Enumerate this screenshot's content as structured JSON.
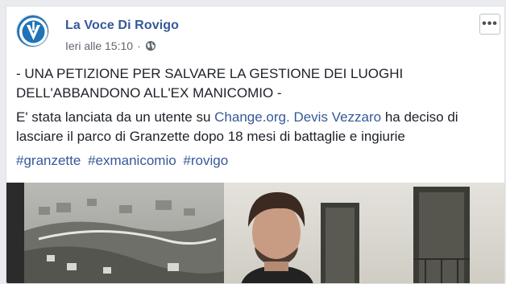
{
  "post": {
    "page_name": "La Voce Di Rovigo",
    "timestamp": "Ieri alle 15:10",
    "meta_separator": "·",
    "more_label": "•••",
    "headline": "- UNA PETIZIONE PER SALVARE LA GESTIONE DEI LUOGHI DELL'ABBANDONO ALL'EX MANICOMIO -",
    "body": {
      "part1": "E' stata lanciata da un utente su ",
      "link1": "Change.org.",
      "space": " ",
      "link2": "Devis Vezzaro",
      "part2": " ha deciso di lasciare il parco di Granzette dopo 18 mesi di battaglie e ingiurie"
    },
    "hashtags": [
      "#granzette",
      "#exmanicomio",
      "#rovigo"
    ]
  },
  "colors": {
    "link": "#365899",
    "text": "#1d2129",
    "meta": "#616770",
    "brand_blue": "#1f73b7"
  },
  "icons": {
    "globe": "globe-icon",
    "more": "more-options-icon",
    "avatar": "page-logo"
  }
}
